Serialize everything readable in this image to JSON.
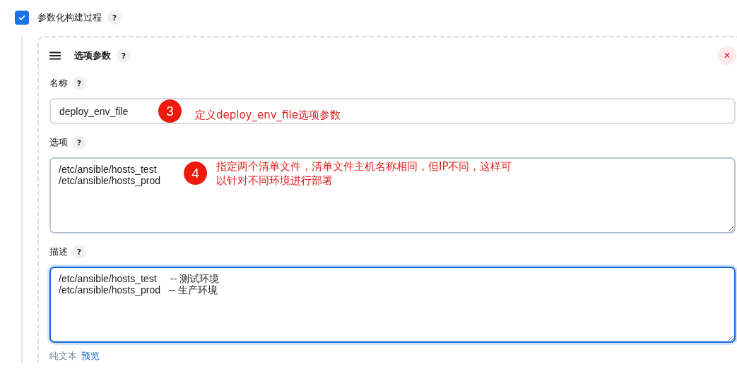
{
  "parameterized": {
    "label": "参数化构建过程",
    "checked": true,
    "help": "?"
  },
  "parameter": {
    "title": "选项参数",
    "help": "?",
    "close": "×",
    "fields": [
      {
        "kind": "input",
        "label": "名称",
        "help": "?",
        "focused": false,
        "lines": [
          "deploy_env_file"
        ],
        "annotation": {
          "number": "3",
          "text": "定义deploy_env_file选项参数"
        }
      },
      {
        "kind": "textarea",
        "label": "选项",
        "help": "?",
        "focused": false,
        "lines": [
          "/etc/ansible/hosts_test",
          "/etc/ansible/hosts_prod"
        ],
        "annotation": {
          "number": "4",
          "text": "指定两个清单文件，清单文件主机名称相同，但IP不同，这样可以针对不同环境进行部署"
        }
      },
      {
        "kind": "textarea",
        "label": "描述",
        "help": "?",
        "focused": true,
        "lines": [
          "/etc/ansible/hosts_test     -- 测试环境",
          "/etc/ansible/hosts_prod   -- 生产环境"
        ],
        "links": [
          {
            "label": "纯文本",
            "selected": true
          },
          {
            "label": "预览",
            "selected": false
          }
        ]
      }
    ]
  }
}
